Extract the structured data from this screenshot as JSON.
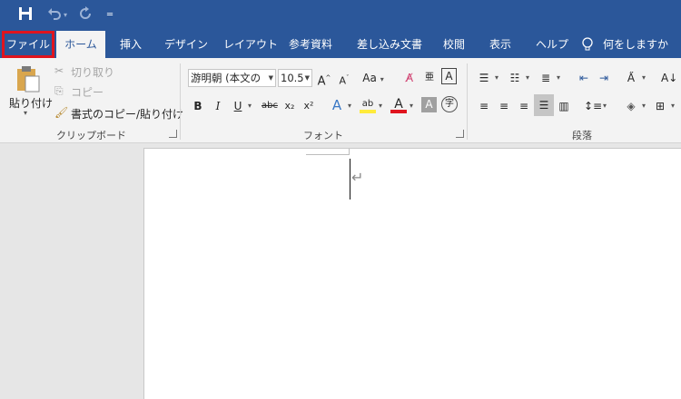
{
  "quick_access": {
    "save_icon": "save-icon",
    "undo_icon": "undo-icon",
    "redo_icon": "redo-icon",
    "customize_icon": "customize-qat-icon"
  },
  "tabs": {
    "file": "ファイル",
    "home": "ホーム",
    "insert": "挿入",
    "design": "デザイン",
    "layout": "レイアウト",
    "references": "参考資料",
    "mailings": "差し込み文書",
    "review": "校閲",
    "view": "表示",
    "help": "ヘルプ",
    "tell_me": "何をしますか"
  },
  "clipboard": {
    "paste": "貼り付け",
    "cut": "切り取り",
    "copy": "コピー",
    "format_painter": "書式のコピー/貼り付け",
    "group_label": "クリップボード"
  },
  "font": {
    "font_name": "游明朝 (本文の",
    "font_size": "10.5",
    "grow": "A",
    "shrink": "A",
    "change_case": "Aa",
    "bold": "B",
    "italic": "I",
    "underline": "U",
    "strike": "abc",
    "subscript": "x₂",
    "superscript": "x²",
    "group_label": "フォント"
  },
  "paragraph": {
    "group_label": "段落"
  },
  "colors": {
    "ribbon_blue": "#2b579a",
    "file_highlight": "#e0141e",
    "font_color_red": "#e0141e",
    "highlight_yellow": "#ffeb3b"
  }
}
